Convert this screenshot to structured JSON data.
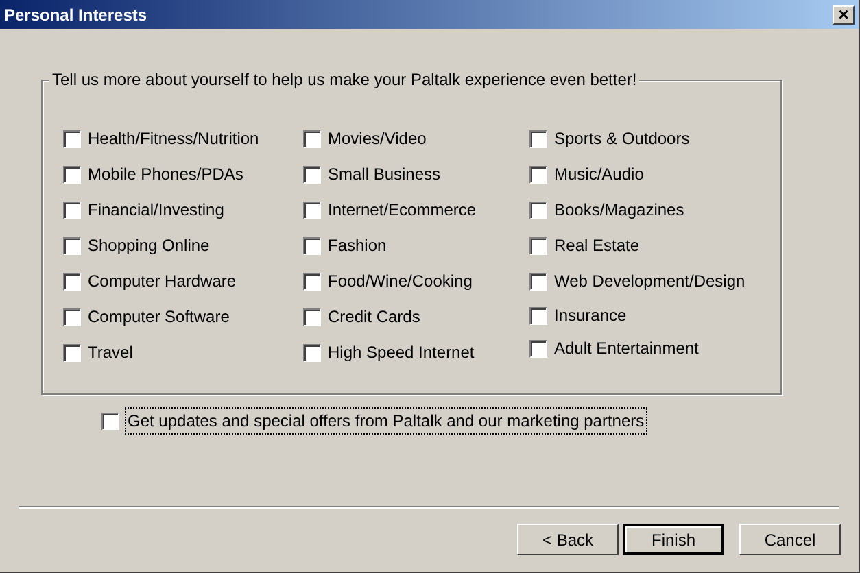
{
  "window": {
    "title": "Personal Interests",
    "close": "×"
  },
  "group": {
    "caption": "Tell us more about yourself to help us make your Paltalk experience even better!",
    "columns": [
      [
        {
          "label": "Health/Fitness/Nutrition",
          "checked": false
        },
        {
          "label": "Mobile Phones/PDAs",
          "checked": false
        },
        {
          "label": "Financial/Investing",
          "checked": false
        },
        {
          "label": "Shopping Online",
          "checked": false
        },
        {
          "label": "Computer Hardware",
          "checked": false
        },
        {
          "label": "Computer Software",
          "checked": false
        },
        {
          "label": "Travel",
          "checked": false
        }
      ],
      [
        {
          "label": "Movies/Video",
          "checked": false
        },
        {
          "label": "Small Business",
          "checked": false
        },
        {
          "label": "Internet/Ecommerce",
          "checked": false
        },
        {
          "label": "Fashion",
          "checked": false
        },
        {
          "label": "Food/Wine/Cooking",
          "checked": false
        },
        {
          "label": "Credit Cards",
          "checked": false
        },
        {
          "label": "High Speed Internet",
          "checked": false
        }
      ],
      [
        {
          "label": "Sports & Outdoors",
          "checked": false
        },
        {
          "label": "Music/Audio",
          "checked": false
        },
        {
          "label": "Books/Magazines",
          "checked": false
        },
        {
          "label": "Real Estate",
          "checked": false
        },
        {
          "label": "Web Development/Design",
          "checked": false
        },
        {
          "label": "Insurance",
          "checked": false
        },
        {
          "label": "Adult Entertainment",
          "checked": false
        }
      ]
    ]
  },
  "updates": {
    "label": "Get updates and special offers from Paltalk and our marketing partners",
    "checked": false,
    "focused": true
  },
  "buttons": [
    {
      "label": "< Back",
      "default": false
    },
    {
      "label": "Finish",
      "default": true
    },
    {
      "label": "Cancel",
      "default": false
    }
  ]
}
